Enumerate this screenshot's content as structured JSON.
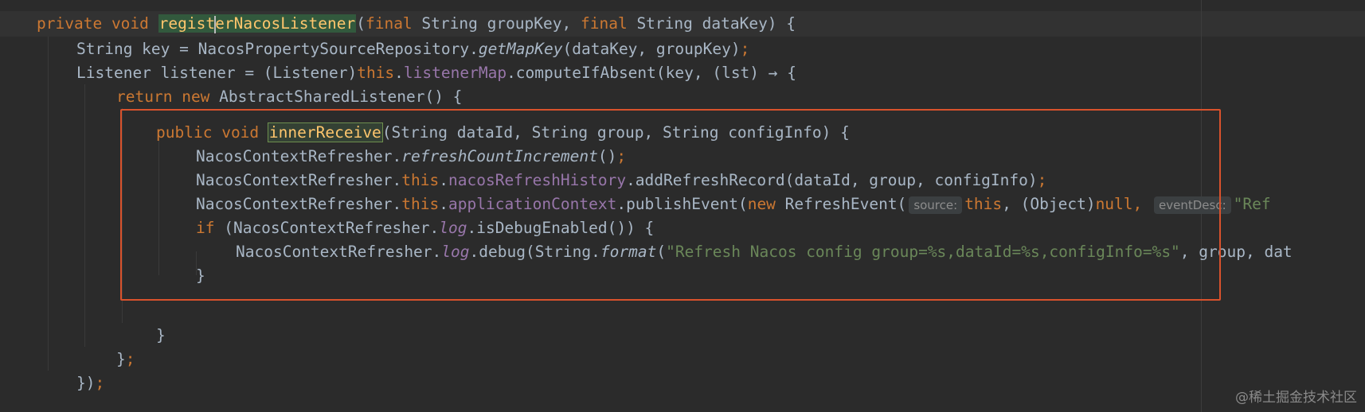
{
  "code": {
    "l1": {
      "private": "private",
      "void": "void",
      "name_before_caret": "regist",
      "name_after_caret": "erNacosListener",
      "paren_open": "(",
      "final1": "final",
      "params1": " String groupKey, ",
      "final2": "final",
      "params2": " String dataKey) {"
    },
    "l2": {
      "t1": "String key = NacosPropertySourceRepository.",
      "method": "getMapKey",
      "t2": "(dataKey, groupKey)",
      "semi": ";"
    },
    "l3": {
      "t1": "Listener listener = (Listener)",
      "this": "this",
      "dot": ".",
      "field": "listenerMap",
      "t2": ".computeIfAbsent(key, (lst) → {"
    },
    "l4": {
      "return": "return",
      "new": "new",
      "t1": " AbstractSharedListener() {"
    },
    "l5": {
      "public": "public",
      "void": "void",
      "method": "innerReceive",
      "t1": "(String dataId, String group, String configInfo) {"
    },
    "l6": {
      "t1": "NacosContextRefresher.",
      "method": "refreshCountIncrement",
      "t2": "()",
      "semi": ";"
    },
    "l7": {
      "t1": "NacosContextRefresher.",
      "this": "this",
      "dot": ".",
      "field": "nacosRefreshHistory",
      "t2": ".addRefreshRecord(dataId, group, configInfo)",
      "semi": ";"
    },
    "l8": {
      "t1": "NacosContextRefresher.",
      "this": "this",
      "dot": ".",
      "field": "applicationContext",
      "t2": ".publishEvent(",
      "new": "new",
      "t3": " RefreshEvent(",
      "hint1": "source:",
      "this2": "this",
      "t4": ", (Object)",
      "null": "null",
      "comma": ",",
      "hint2": "eventDesc:",
      "str": "\"Ref"
    },
    "l9": {
      "if": "if",
      "t1": " (NacosContextRefresher.",
      "field": "log",
      "t2": ".isDebugEnabled()) {"
    },
    "l10": {
      "t1": "NacosContextRefresher.",
      "field": "log",
      "t2": ".debug(String.",
      "method": "format",
      "paren": "(",
      "str": "\"Refresh Nacos config group=%s,dataId=%s,configInfo=%s\"",
      "t3": ", group, dat"
    },
    "l11": {
      "t1": "}"
    },
    "l12": {
      "t1": "}"
    },
    "l13": {
      "t1": "}",
      "semi": ";"
    },
    "l14": {
      "t1": "})",
      "semi": ";"
    }
  },
  "watermark": "@稀土掘金技术社区",
  "colors": {
    "background": "#2b2b2b",
    "keyword": "#cc7832",
    "method": "#ffc66d",
    "field": "#9876aa",
    "string": "#6a8759",
    "text": "#a9b7c6",
    "annotation_box": "#d9522c"
  }
}
